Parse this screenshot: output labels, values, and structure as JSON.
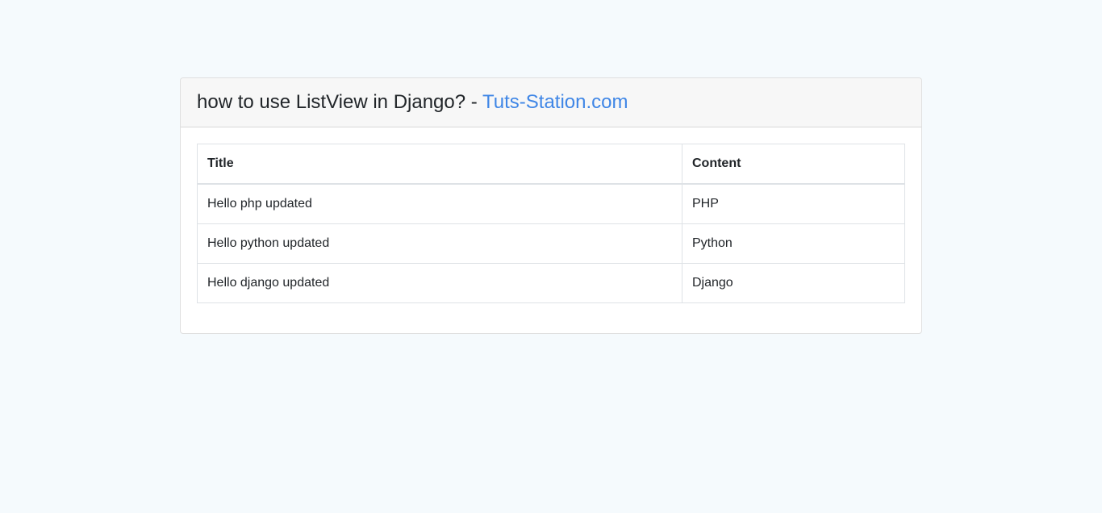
{
  "header": {
    "title_prefix": "how to use ListView in Django? - ",
    "title_link": "Tuts-Station.com",
    "link_color": "#3f86e6"
  },
  "table": {
    "columns": [
      "Title",
      "Content"
    ],
    "rows": [
      {
        "title": "Hello php updated",
        "content": "PHP"
      },
      {
        "title": "Hello python updated",
        "content": "Python"
      },
      {
        "title": "Hello django updated",
        "content": "Django"
      }
    ]
  }
}
